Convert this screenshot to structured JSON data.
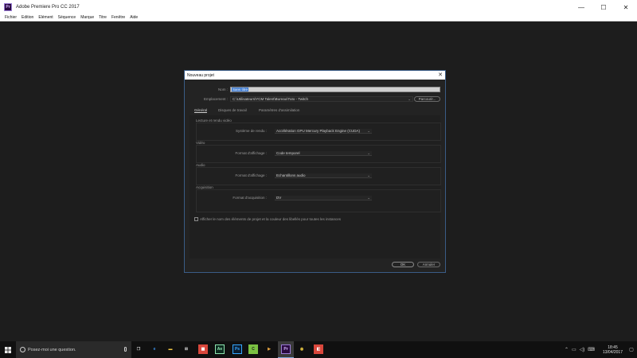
{
  "app": {
    "title": "Adobe Premiere Pro CC 2017",
    "icon_text": "Pr",
    "window_controls": {
      "minimize": "—",
      "maximize": "☐",
      "close": "✕"
    }
  },
  "menu": [
    "Fichier",
    "Edition",
    "Elément",
    "Séquence",
    "Marque",
    "Titre",
    "Fenêtre",
    "Aide"
  ],
  "dialog": {
    "title": "Nouveau projet",
    "close": "✕",
    "name_label": "Nom :",
    "name_value": "Sans titre",
    "location_label": "Emplacement :",
    "location_value": "C:\\Utilisateurs\\YCM Talent\\Bureau\\Tuto - Twitch",
    "browse_label": "Parcourir...",
    "tabs": [
      "Général",
      "Disques de travail",
      "Paramètres d'assimilation"
    ],
    "sections": [
      {
        "title": "Lecture et rendu vidéo",
        "field_label": "Système de rendu :",
        "value": "Accélération GPU Mercury Playback Engine (CUDA)"
      },
      {
        "title": "Vidéo",
        "field_label": "Format d'affichage :",
        "value": "Code temporel"
      },
      {
        "title": "Audio",
        "field_label": "Format d'affichage :",
        "value": "Echantillons audio"
      },
      {
        "title": "Acquisition",
        "field_label": "Format d'acquisition :",
        "value": "DV"
      }
    ],
    "checkbox_label": "Afficher le nom des éléments de projet et la couleur des libellés pour toutes les instances",
    "ok": "OK",
    "cancel": "Annuler"
  },
  "taskbar": {
    "search_placeholder": "Posez-moi une question.",
    "pinned": [
      "Ae",
      "Ps",
      "Pr"
    ],
    "time": "18:45",
    "date": "13/04/2017"
  },
  "colors": {
    "accent": "#3a78d0",
    "dialog_border": "#3a5c86",
    "premiere": "#9a7cd6"
  }
}
